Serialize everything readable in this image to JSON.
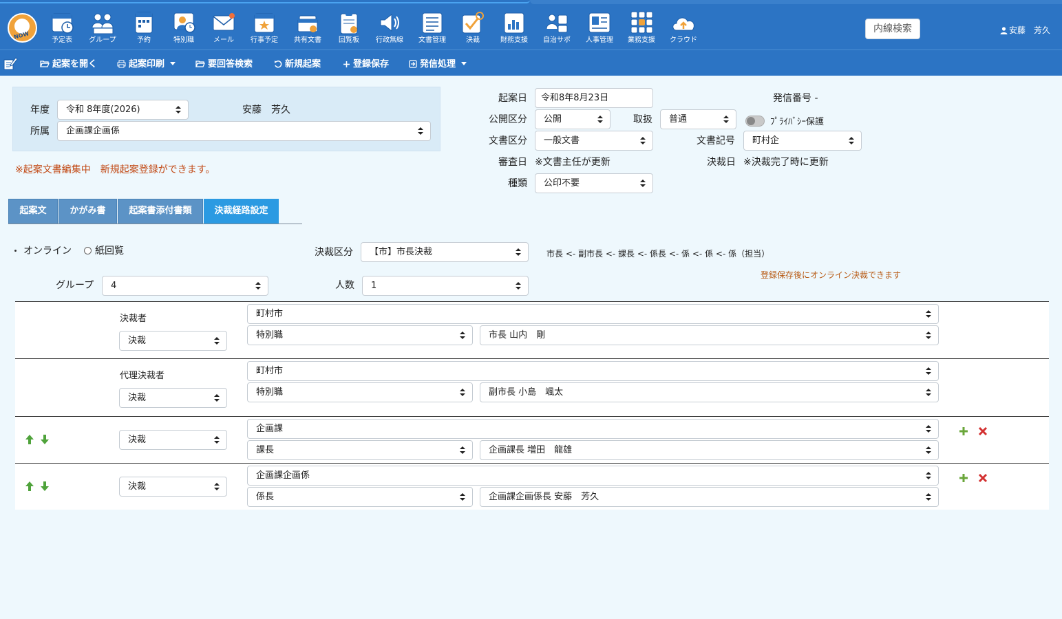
{
  "apps": [
    {
      "label": "予定表",
      "icon": "calendar-clock-icon"
    },
    {
      "label": "グループ",
      "icon": "group-icon"
    },
    {
      "label": "予約",
      "icon": "reservation-icon"
    },
    {
      "label": "特別職",
      "icon": "special-staff-icon"
    },
    {
      "label": "メール",
      "icon": "mail-icon"
    },
    {
      "label": "行事予定",
      "icon": "event-calendar-icon"
    },
    {
      "label": "共有文書",
      "icon": "shared-docs-icon"
    },
    {
      "label": "回覧板",
      "icon": "circular-board-icon"
    },
    {
      "label": "行政無線",
      "icon": "radio-broadcast-icon"
    },
    {
      "label": "文書管理",
      "icon": "document-management-icon"
    },
    {
      "label": "決裁",
      "icon": "approval-icon"
    },
    {
      "label": "財務支援",
      "icon": "finance-icon"
    },
    {
      "label": "自治サポ",
      "icon": "support-icon"
    },
    {
      "label": "人事管理",
      "icon": "hr-icon"
    },
    {
      "label": "業務支援",
      "icon": "grid-apps-icon"
    },
    {
      "label": "クラウド",
      "icon": "cloud-icon"
    }
  ],
  "header": {
    "logo_text": "NOW",
    "search_label": "内線検索",
    "user_name": "安藤　芳久"
  },
  "toolbar": {
    "open": "起案を開く",
    "print": "起案印刷",
    "search": "要回答検索",
    "new": "新規起案",
    "save": "登録保存",
    "send": "発信処理"
  },
  "form": {
    "year_label": "年度",
    "year_value": "令和 8年度(2026)",
    "author": "安藤　芳久",
    "dept_label": "所属",
    "dept_value": "企画課企画係",
    "draft_date_label": "起案日",
    "draft_date_value": "令和8年8月23日",
    "send_no_label": "発信番号 -",
    "public_label": "公開区分",
    "public_value": "公開",
    "handling_label": "取扱",
    "handling_value": "普通",
    "privacy_label": "ﾌﾟﾗｲﾊﾞｼｰ保護",
    "doc_type_label": "文書区分",
    "doc_type_value": "一般文書",
    "doc_code_label": "文書記号",
    "doc_code_value": "町村企",
    "review_label": "審査日",
    "review_value": "※文書主任が更新",
    "decision_label": "決裁日",
    "decision_value": "※決裁完了時に更新",
    "kind_label": "種類",
    "kind_value": "公印不要",
    "warning": "※起案文書編集中　新規起案登録ができます。"
  },
  "tabs": [
    "起案文",
    "かがみ書",
    "起案書添付書類",
    "決裁経路設定"
  ],
  "route": {
    "online_label": "オンライン",
    "paper_label": "紙回覧",
    "category_label": "決裁区分",
    "category_value": "【市】市長決裁",
    "chain": "市長 <- 副市長 <- 課長 <- 係長 <- 係 <- 係 <- 係（担当）",
    "group_label": "グループ",
    "group_value": "4",
    "count_label": "人数",
    "count_value": "1",
    "note": "登録保存後にオンライン決裁できます",
    "rows": [
      {
        "role": "決裁者",
        "type": "決裁",
        "org": "町村市",
        "post": "特別職",
        "person": "市長 山内　剛"
      },
      {
        "role": "代理決裁者",
        "type": "決裁",
        "org": "町村市",
        "post": "特別職",
        "person": "副市長 小島　颯太"
      },
      {
        "role": "",
        "type": "決裁",
        "org": "企画課",
        "post": "課長",
        "person": "企画課長 増田　龍雄"
      },
      {
        "role": "",
        "type": "決裁",
        "org": "企画課企画係",
        "post": "係長",
        "person": "企画課企画係長 安藤　芳久"
      }
    ]
  },
  "colors": {
    "header": "#2c74c4",
    "accent": "#2b9ae2",
    "warning": "#c24a16",
    "background": "#eef8fd"
  }
}
